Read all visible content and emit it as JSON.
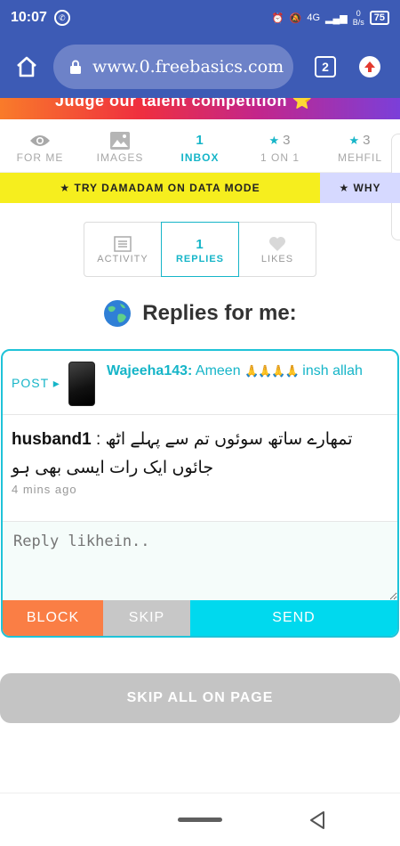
{
  "status": {
    "time": "10:07",
    "network": "4G",
    "speed_value": "0",
    "speed_unit": "B/s",
    "battery": "75"
  },
  "browser": {
    "url": "www.0.freebasics.com",
    "tab_count": "2"
  },
  "banner": {
    "text": "Judge our talent competition ⭐"
  },
  "nav": {
    "items": [
      {
        "top": "",
        "label": "FOR ME",
        "icon": "eye-icon"
      },
      {
        "top": "",
        "label": "IMAGES",
        "icon": "image-icon"
      },
      {
        "top": "1",
        "label": "INBOX",
        "active": true
      },
      {
        "top": "3",
        "label": "1 ON 1",
        "icon": "star-icon"
      },
      {
        "top": "3",
        "label": "MEHFIL",
        "icon": "star-icon"
      }
    ]
  },
  "data_strip": {
    "left": "★ TRY DAMADAM ON DATA MODE",
    "right": "★ WHY"
  },
  "subtabs": [
    {
      "top": "",
      "label": "ACTIVITY",
      "icon": "list-icon"
    },
    {
      "top": "1",
      "label": "REPLIES",
      "active": true
    },
    {
      "top": "",
      "label": "LIKES",
      "icon": "heart-icon"
    }
  ],
  "heading": "Replies for me:",
  "card": {
    "post_link": "POST ▸",
    "post_user": "Wajeeha143:",
    "post_text": "Ameen",
    "post_text_end": "insh allah",
    "reply_user": "husband1",
    "reply_text": ": تمھارے ساتھ سوئوں تم سے پہلے اٹھ جائوں ایک رات ایسی بھی ہو",
    "reply_time": "4 mins ago",
    "reply_placeholder": "Reply likhein..",
    "block_label": "BLOCK",
    "skip_label": "SKIP",
    "send_label": "SEND"
  },
  "skip_all_label": "SKIP ALL ON PAGE",
  "colors": {
    "brand_blue": "#3d5bb5",
    "accent": "#16b5c8",
    "block": "#fa7e45",
    "send": "#00d9ee",
    "data_yellow": "#f6ee1e"
  }
}
